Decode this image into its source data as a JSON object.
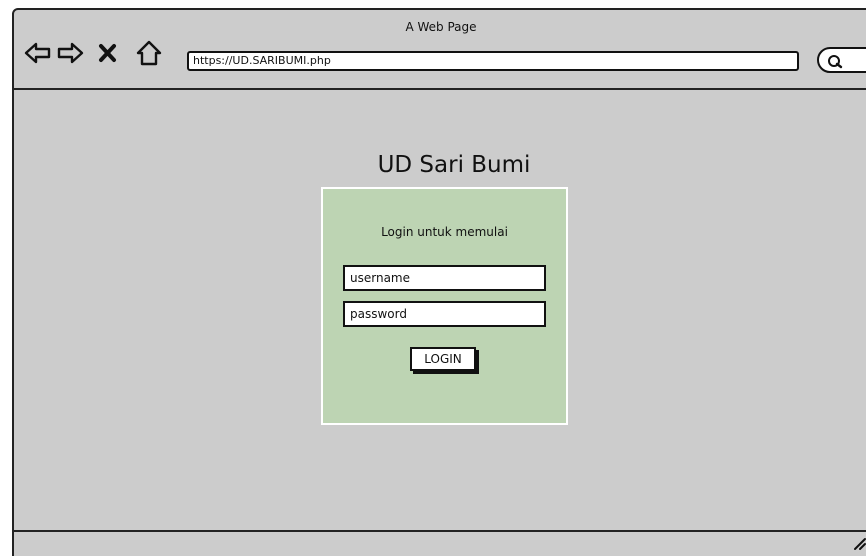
{
  "browser": {
    "title": "A Web Page",
    "url": "https://UD.SARIBUMI.php",
    "icons": [
      "back-arrow-icon",
      "forward-arrow-icon",
      "close-icon",
      "home-icon",
      "search-icon",
      "resize-handle-icon"
    ]
  },
  "page": {
    "title": "UD Sari Bumi"
  },
  "login": {
    "subtitle": "Login untuk memulai",
    "username_value": "username",
    "password_value": "password",
    "button_label": "LOGIN"
  },
  "colors": {
    "window_bg": "#cccccc",
    "panel_bg": "#bdd4b3"
  }
}
